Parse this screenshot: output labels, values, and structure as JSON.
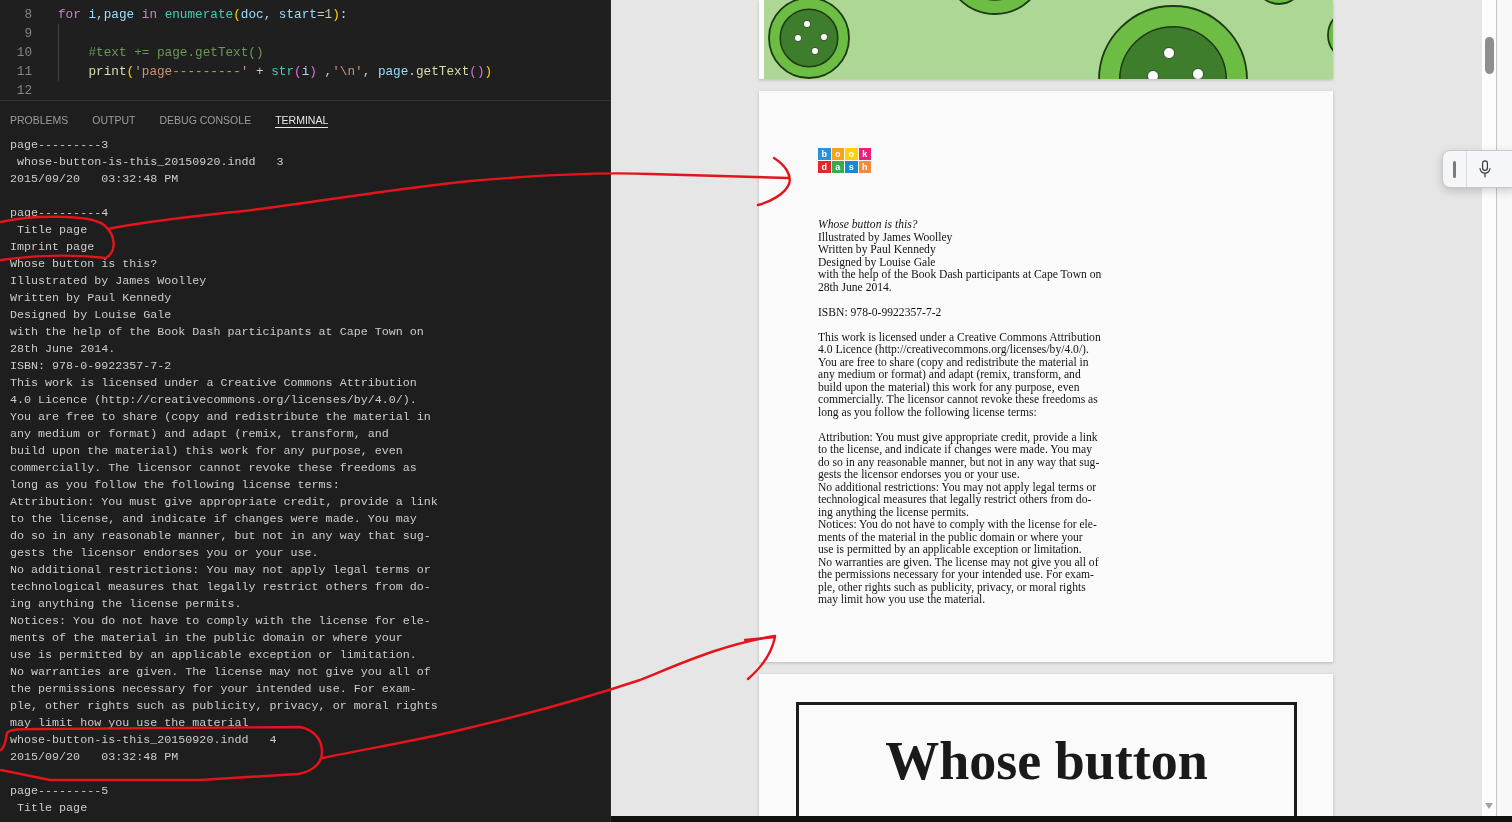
{
  "editor": {
    "lines": [
      {
        "number": "8",
        "indent_guide": false,
        "tokens": [
          {
            "kind": "keyword",
            "text": "for"
          },
          {
            "kind": "variable",
            "text": " i"
          },
          {
            "kind": "plain",
            "text": ","
          },
          {
            "kind": "variable",
            "text": "page"
          },
          {
            "kind": "keyword",
            "text": " in"
          },
          {
            "kind": "builtin",
            "text": " enumerate"
          },
          {
            "kind": "bracket1",
            "text": "("
          },
          {
            "kind": "variable",
            "text": "doc"
          },
          {
            "kind": "plain",
            "text": ","
          },
          {
            "kind": "variable",
            "text": " start"
          },
          {
            "kind": "plain",
            "text": "="
          },
          {
            "kind": "number",
            "text": "1"
          },
          {
            "kind": "bracket1",
            "text": ")"
          },
          {
            "kind": "plain",
            "text": ":"
          }
        ]
      },
      {
        "number": "9",
        "indent_guide": true
      },
      {
        "number": "10",
        "indent_guide": true,
        "tokens": [
          {
            "kind": "comment",
            "text": "    #text += page.getText()"
          }
        ]
      },
      {
        "number": "11",
        "indent_guide": true,
        "tokens": [
          {
            "kind": "function",
            "text": "    print"
          },
          {
            "kind": "bracket1",
            "text": "("
          },
          {
            "kind": "string",
            "text": "'page---------'"
          },
          {
            "kind": "plain",
            "text": " + "
          },
          {
            "kind": "builtin",
            "text": "str"
          },
          {
            "kind": "bracket2",
            "text": "("
          },
          {
            "kind": "variable",
            "text": "i"
          },
          {
            "kind": "bracket2",
            "text": ")"
          },
          {
            "kind": "plain",
            "text": " ,"
          },
          {
            "kind": "string",
            "text": "'\\n'"
          },
          {
            "kind": "plain",
            "text": ", "
          },
          {
            "kind": "variable",
            "text": "page"
          },
          {
            "kind": "plain",
            "text": "."
          },
          {
            "kind": "function",
            "text": "getText"
          },
          {
            "kind": "bracket2",
            "text": "()"
          },
          {
            "kind": "bracket1",
            "text": ")"
          }
        ]
      },
      {
        "number": "12",
        "indent_guide": false
      }
    ]
  },
  "panel": {
    "tabs": [
      {
        "label": "PROBLEMS",
        "selected": false
      },
      {
        "label": "OUTPUT",
        "selected": false
      },
      {
        "label": "DEBUG CONSOLE",
        "selected": false
      },
      {
        "label": "TERMINAL",
        "selected": true
      }
    ]
  },
  "terminal": {
    "blocks": [
      [
        "page---------3",
        " whose-button-is-this_20150920.indd   3",
        "2015/09/20   03:32:48 PM"
      ],
      [
        "page---------4",
        " Title page",
        "Imprint page",
        "Whose button is this?",
        "Illustrated by James Woolley",
        "Written by Paul Kennedy",
        "Designed by Louise Gale",
        "with the help of the Book Dash participants at Cape Town on",
        "28th June 2014.",
        "ISBN: 978-0-9922357-7-2",
        "This work is licensed under a Creative Commons Attribution",
        "4.0 Licence (http://creativecommons.org/licenses/by/4.0/).",
        "You are free to share (copy and redistribute the material in",
        "any medium or format) and adapt (remix, transform, and",
        "build upon the material) this work for any purpose, even",
        "commercially. The licensor cannot revoke these freedoms as",
        "long as you follow the following license terms:",
        "Attribution: You must give appropriate credit, provide a link",
        "to the license, and indicate if changes were made. You may",
        "do so in any reasonable manner, but not in any way that sug-",
        "gests the licensor endorses you or your use.",
        "No additional restrictions: You may not apply legal terms or",
        "technological measures that legally restrict others from do-",
        "ing anything the license permits.",
        "Notices: You do not have to comply with the license for ele-",
        "ments of the material in the public domain or where your",
        "use is permitted by an applicable exception or limitation.",
        "No warranties are given. The license may not give you all of",
        "the permissions necessary for your intended use. For exam-",
        "ple, other rights such as publicity, privacy, or moral rights",
        "may limit how you use the material",
        "whose-button-is-this_20150920.indd   4",
        "2015/09/20   03:32:48 PM"
      ],
      [
        "page---------5",
        " Title page"
      ]
    ]
  },
  "pdf_viewer": {
    "pages": [
      {
        "kind": "illustration"
      },
      {
        "kind": "imprint",
        "logo": [
          {
            "letter": "b",
            "color": "#2b8fd9"
          },
          {
            "letter": "o",
            "color": "#f7a21b"
          },
          {
            "letter": "o",
            "color": "#fdd20a"
          },
          {
            "letter": "k",
            "color": "#e6227a"
          },
          {
            "letter": "d",
            "color": "#e3262e"
          },
          {
            "letter": "a",
            "color": "#3aaa4a"
          },
          {
            "letter": "s",
            "color": "#1c87c9"
          },
          {
            "letter": "h",
            "color": "#f58a3b"
          }
        ],
        "sections": [
          [
            {
              "kind": "title",
              "text": "Whose button is this?"
            },
            {
              "kind": "credit",
              "text": "Illustrated by James Woolley"
            },
            {
              "kind": "credit",
              "text": "Written by Paul Kennedy"
            },
            {
              "kind": "credit",
              "text": "Designed by Louise Gale"
            },
            {
              "kind": "credit",
              "text": "with the help of the Book Dash participants at Cape Town on\n28th June 2014."
            }
          ],
          [
            {
              "kind": "isbn",
              "text": "ISBN: 978-0-9922357-7-2"
            }
          ],
          [
            {
              "kind": "paragraph",
              "text": "This work is licensed under a Creative Commons Attribution\n4.0 Licence (http://creativecommons.org/licenses/by/4.0/).\nYou are free to share (copy and redistribute the material in\nany medium or format) and adapt (remix, transform, and\nbuild upon the material) this work for any purpose, even\ncommercially. The licensor cannot revoke these freedoms as\nlong as you follow the following license terms:"
            }
          ],
          [
            {
              "kind": "paragraph",
              "text": "Attribution: You must give appropriate credit, provide a link\nto the license, and indicate if changes were made. You may\ndo so in any reasonable manner, but not in any way that sug-\ngests the licensor endorses you or your use."
            },
            {
              "kind": "paragraph",
              "text": "No additional restrictions: You may not apply legal terms or\ntechnological measures that legally restrict others from do-\ning anything the license permits."
            },
            {
              "kind": "paragraph",
              "text": "Notices: You do not have to comply with the license for ele-\nments of the material in the public domain or where your\nuse is permitted by an applicable exception or limitation."
            },
            {
              "kind": "paragraph",
              "text": "No warranties are given. The license may not give you all of\nthe permissions necessary for your intended use. For exam-\nple, other rights such as publicity, privacy, or moral rights\nmay limit how you use the material."
            }
          ]
        ]
      },
      {
        "kind": "title",
        "heading": "Whose button"
      }
    ]
  }
}
